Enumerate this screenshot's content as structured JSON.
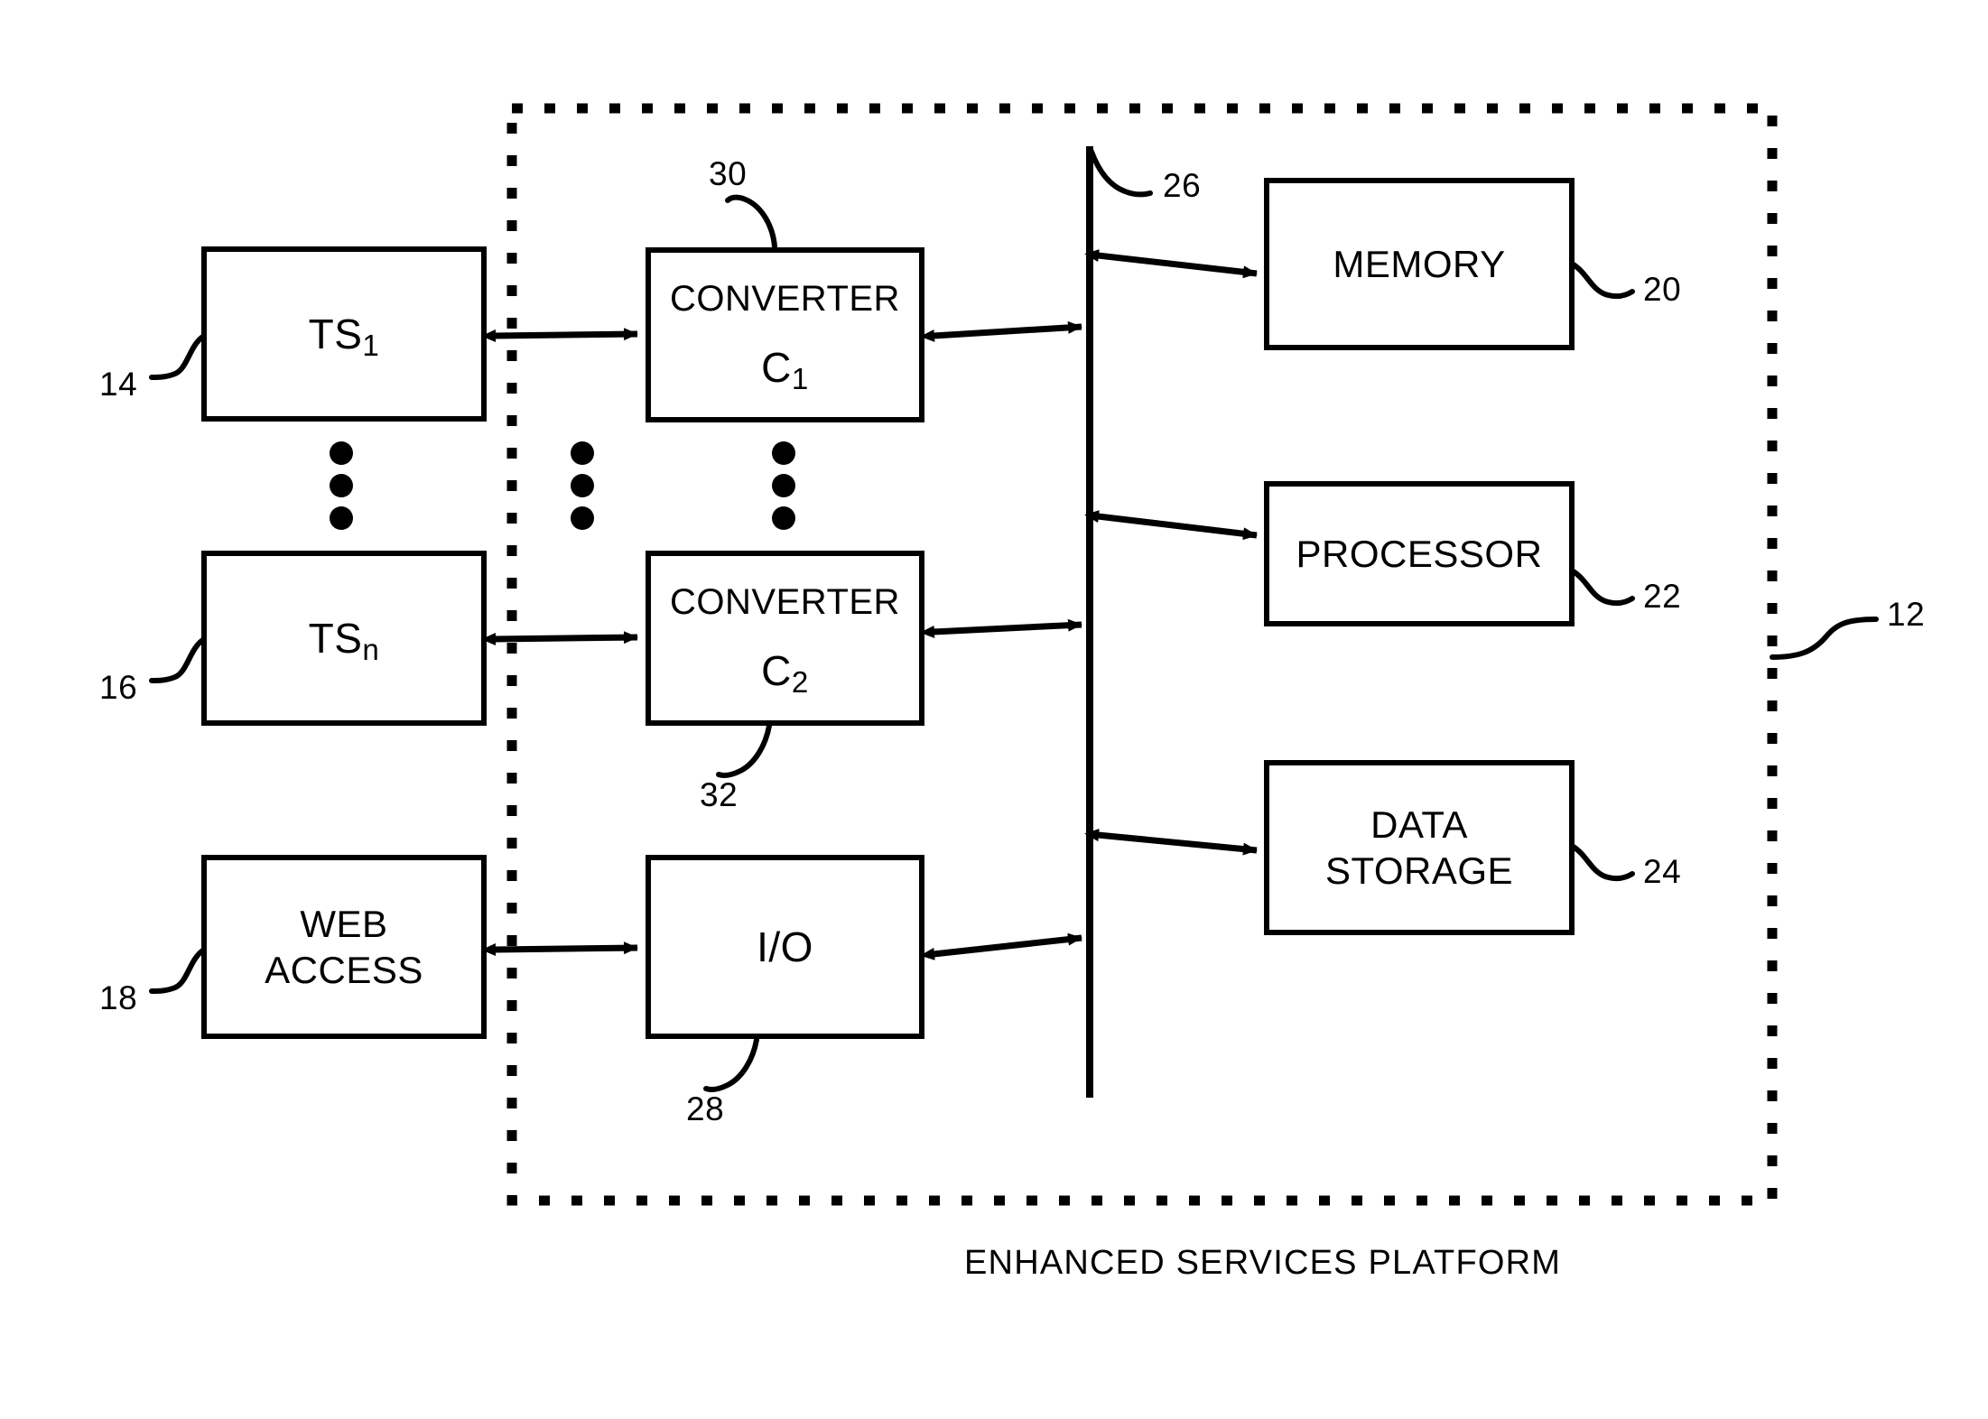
{
  "figure": {
    "caption": "ENHANCED SERVICES PLATFORM",
    "platform_ref": "12",
    "bus_ref": "26"
  },
  "external_blocks": [
    {
      "id": "ts1",
      "label_main": "TS",
      "label_sub": "1",
      "ref": "14"
    },
    {
      "id": "tsn",
      "label_main": "TS",
      "label_sub": "n",
      "ref": "16"
    },
    {
      "id": "web-access",
      "line1": "WEB",
      "line2": "ACCESS",
      "ref": "18"
    }
  ],
  "interface_blocks": [
    {
      "id": "converter-c1",
      "line1": "CONVERTER",
      "line2": "C",
      "sub": "1",
      "ref": "30"
    },
    {
      "id": "converter-c2",
      "line1": "CONVERTER",
      "line2": "C",
      "sub": "2",
      "ref": "32"
    },
    {
      "id": "io",
      "line1": "I/O",
      "ref": "28"
    }
  ],
  "resource_blocks": [
    {
      "id": "memory",
      "line1": "MEMORY",
      "ref": "20"
    },
    {
      "id": "processor",
      "line1": "PROCESSOR",
      "ref": "22"
    },
    {
      "id": "data-storage",
      "line1": "DATA",
      "line2": "STORAGE",
      "ref": "24"
    }
  ],
  "ellipses": [
    {
      "id": "ellipsis-terminals"
    },
    {
      "id": "ellipsis-boundary"
    },
    {
      "id": "ellipsis-converters"
    }
  ],
  "colors": {
    "stroke": "#000000",
    "background": "#ffffff"
  }
}
